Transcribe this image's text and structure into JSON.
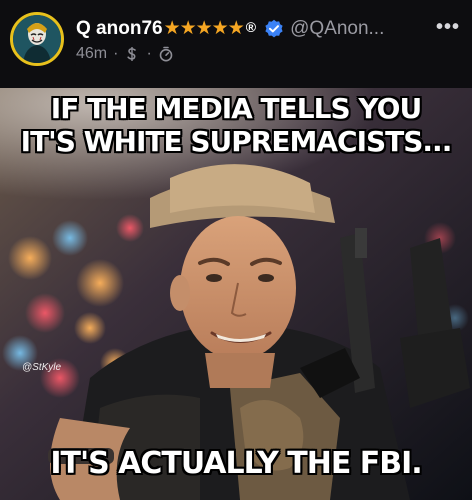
{
  "post": {
    "author": {
      "display_name": "Q anon76",
      "stars": "★★★★★",
      "registered_mark": "®",
      "handle": "@QAnon...",
      "verified_color": "#3b82f6",
      "avatar_icon": "masked-figure-avatar"
    },
    "meta": {
      "time_ago": "46m",
      "separator": "·",
      "icons": [
        "cashtag-s-icon",
        "timer-icon"
      ]
    },
    "more_label": "•••",
    "meme": {
      "top_text_line1": "IF THE MEDIA TELLS YOU",
      "top_text_line2": "IT'S WHITE SUPREMACISTS...",
      "bottom_text": "IT'S ACTUALLY THE FBI.",
      "watermark": "@StKyle"
    }
  },
  "colors": {
    "background": "#0d0d10",
    "star": "#f5a623",
    "avatar_ring": "#e8c11c",
    "meta_text": "#8e8e96"
  }
}
